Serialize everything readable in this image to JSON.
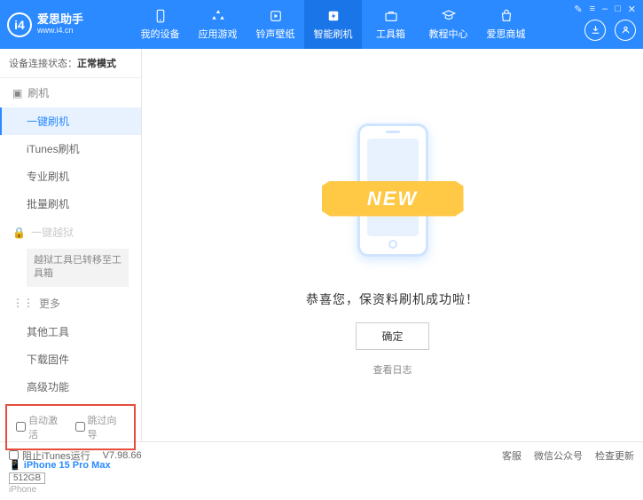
{
  "header": {
    "logo_text": "爱思助手",
    "logo_sub": "www.i4.cn",
    "tabs": [
      {
        "label": "我的设备"
      },
      {
        "label": "应用游戏"
      },
      {
        "label": "铃声壁纸"
      },
      {
        "label": "智能刷机"
      },
      {
        "label": "工具箱"
      },
      {
        "label": "教程中心"
      },
      {
        "label": "爱思商城"
      }
    ]
  },
  "sidebar": {
    "status_label": "设备连接状态：",
    "status_value": "正常模式",
    "sec_flash": "刷机",
    "items_flash": [
      "一键刷机",
      "iTunes刷机",
      "专业刷机",
      "批量刷机"
    ],
    "sec_jailbreak": "一键越狱",
    "jailbreak_note": "越狱工具已转移至工具箱",
    "sec_more": "更多",
    "items_more": [
      "其他工具",
      "下载固件",
      "高级功能"
    ],
    "cb_auto_activate": "自动激活",
    "cb_skip_guide": "跳过向导",
    "device_name": "iPhone 15 Pro Max",
    "storage": "512GB",
    "model": "iPhone"
  },
  "main": {
    "banner": "NEW",
    "success": "恭喜您，保资料刷机成功啦！",
    "ok": "确定",
    "view_log": "查看日志"
  },
  "footer": {
    "block_itunes": "阻止iTunes运行",
    "version": "V7.98.66",
    "service": "客服",
    "wechat": "微信公众号",
    "update": "检查更新"
  }
}
